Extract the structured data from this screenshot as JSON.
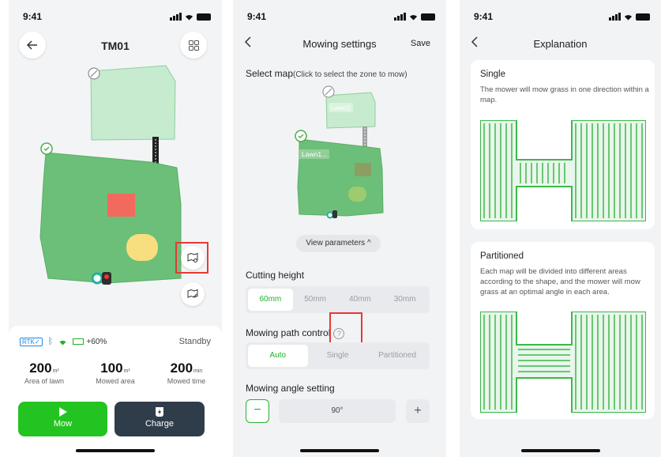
{
  "status": {
    "time": "9:41"
  },
  "device_screen": {
    "title": "TM01",
    "connection": {
      "rtk": "RTK✓",
      "battery": "+60%",
      "state": "Standby"
    },
    "stats": [
      {
        "value": "200",
        "unit": "m²",
        "label": "Area of lawn"
      },
      {
        "value": "100",
        "unit": "m²",
        "label": "Mowed area"
      },
      {
        "value": "200",
        "unit": "min",
        "label": "Mowed time"
      }
    ],
    "mow_label": "Mow",
    "charge_label": "Charge",
    "colors": {
      "lawn": "#6cbf78",
      "lawn_light": "#c6ebce",
      "mow": "#23c421",
      "charge": "#2f3d4b",
      "highlight": "#e53935"
    }
  },
  "settings_screen": {
    "title": "Mowing settings",
    "save_label": "Save",
    "select_map_label": "Select map",
    "select_map_hint": "(Click to select the zone to mow)",
    "zones": [
      {
        "label": "Lawn1"
      },
      {
        "label": "Lawn1..."
      }
    ],
    "view_parameters_label": "View parameters ^",
    "cutting_height": {
      "label": "Cutting height",
      "options": [
        "60mm",
        "50mm",
        "40mm",
        "30mm"
      ],
      "selected": "60mm"
    },
    "path_control": {
      "label": "Mowing path control",
      "options": [
        "Auto",
        "Single",
        "Partitioned"
      ],
      "selected": "Auto"
    },
    "angle": {
      "label": "Mowing angle setting",
      "value": "90°",
      "minus": "−",
      "plus": "+"
    }
  },
  "explanation_screen": {
    "title": "Explanation",
    "cards": [
      {
        "title": "Single",
        "text": "The mower will mow grass in one direction within a map."
      },
      {
        "title": "Partitioned",
        "text": "Each map will be divided into different areas according to the shape, and the mower will mow grass at an optimal angle in each area."
      }
    ],
    "colors": {
      "stripe": "#3cb84a",
      "stripe_bg": "#e9f6eb"
    }
  }
}
